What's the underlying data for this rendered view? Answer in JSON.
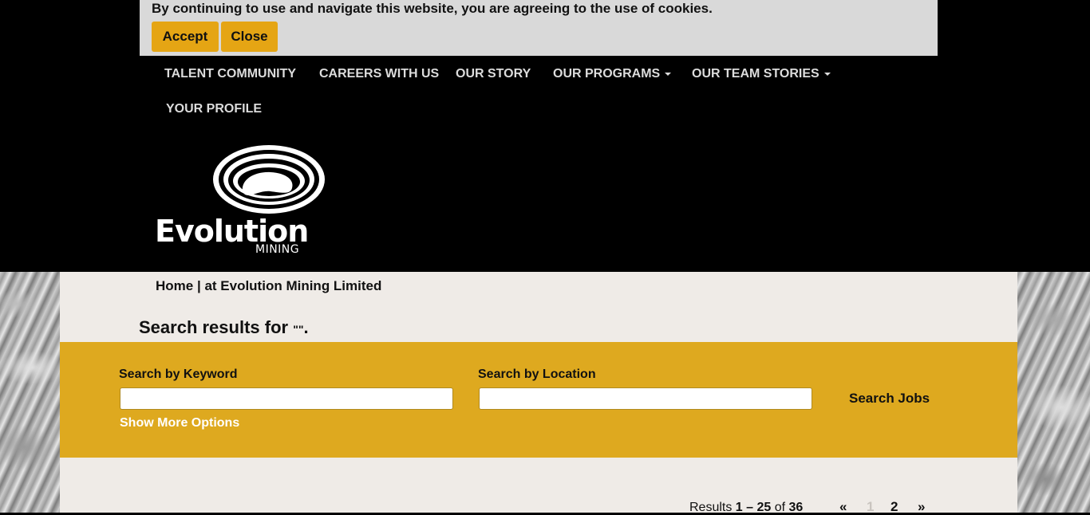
{
  "cookie_banner": {
    "message": "By continuing to use and navigate this website, you are agreeing to the use of cookies.",
    "accept_label": "Accept",
    "close_label": "Close"
  },
  "nav": {
    "items": [
      {
        "label": "TALENT COMMUNITY",
        "dropdown": false
      },
      {
        "label": "CAREERS WITH US",
        "dropdown": false
      },
      {
        "label": "OUR STORY",
        "dropdown": false
      },
      {
        "label": "OUR PROGRAMS",
        "dropdown": true
      },
      {
        "label": "OUR TEAM STORIES",
        "dropdown": true
      },
      {
        "label": "YOUR PROFILE",
        "dropdown": false
      }
    ]
  },
  "logo": {
    "word": "Evolution",
    "sub": "MINING"
  },
  "breadcrumb": {
    "home": "Home",
    "separator": " | ",
    "current": "at Evolution Mining Limited"
  },
  "results_heading": {
    "prefix": "Search results for ",
    "query": "\"\"",
    "suffix": "."
  },
  "search": {
    "keyword_label": "Search by Keyword",
    "keyword_value": "",
    "location_label": "Search by Location",
    "location_value": "",
    "submit_label": "Search Jobs",
    "more_options_label": "Show More Options"
  },
  "pagination": {
    "results_prefix": "Results ",
    "range": "1 – 25",
    "of_word": " of ",
    "total": "36",
    "prev": "«",
    "page_current": "1",
    "page_next": "2",
    "next": "»"
  },
  "colors": {
    "accent": "#dea91f",
    "button": "#e5a514",
    "panel": "#efebe7",
    "header_bg": "#000000"
  }
}
